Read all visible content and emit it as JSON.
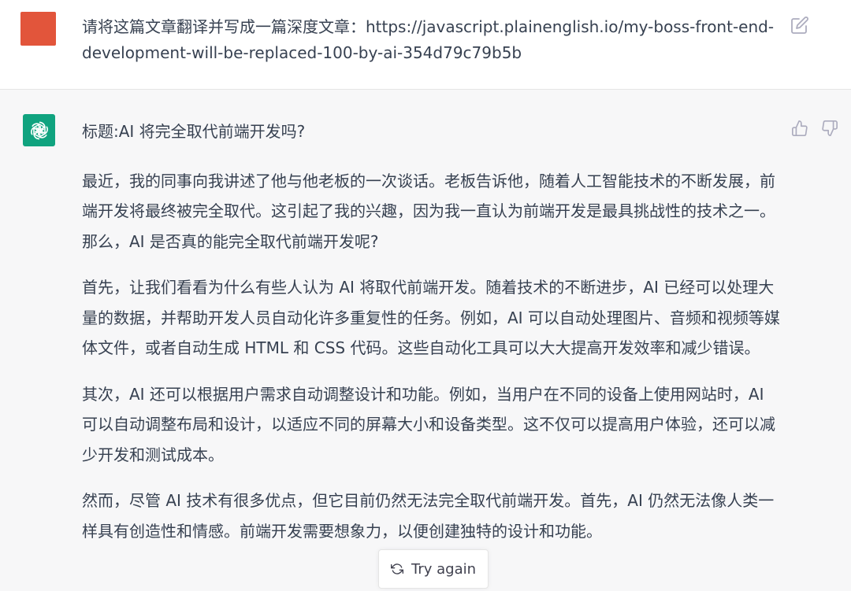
{
  "user_message": {
    "text": "请将这篇文章翻译并写成一篇深度文章：https://javascript.plainenglish.io/my-boss-front-end-development-will-be-replaced-100-by-ai-354d79c79b5b"
  },
  "assistant_message": {
    "title": "标题:AI 将完全取代前端开发吗?",
    "paragraphs": [
      "最近，我的同事向我讲述了他与他老板的一次谈话。老板告诉他，随着人工智能技术的不断发展，前端开发将最终被完全取代。这引起了我的兴趣，因为我一直认为前端开发是最具挑战性的技术之一。那么，AI 是否真的能完全取代前端开发呢?",
      "首先，让我们看看为什么有些人认为 AI 将取代前端开发。随着技术的不断进步，AI 已经可以处理大量的数据，并帮助开发人员自动化许多重复性的任务。例如，AI 可以自动处理图片、音频和视频等媒体文件，或者自动生成 HTML 和 CSS 代码。这些自动化工具可以大大提高开发效率和减少错误。",
      "其次，AI 还可以根据用户需求自动调整设计和功能。例如，当用户在不同的设备上使用网站时，AI 可以自动调整布局和设计，以适应不同的屏幕大小和设备类型。这不仅可以提高用户体验，还可以减少开发和测试成本。",
      "然而，尽管 AI 技术有很多优点，但它目前仍然无法完全取代前端开发。首先，AI 仍然无法像人类一样具有创造性和情感。前端开发需要想象力，以便创建独特的设计和功能。"
    ]
  },
  "controls": {
    "try_again_label": "Try again"
  },
  "icons": {
    "edit": "edit-icon",
    "thumb_up": "thumbs-up-icon",
    "thumb_down": "thumbs-down-icon",
    "regenerate": "refresh-icon",
    "assistant_logo": "openai-logo-icon"
  },
  "colors": {
    "user_avatar": "#e2553b",
    "assistant_avatar": "#10a37f",
    "assistant_bg": "#f7f7f8",
    "user_bg": "#ffffff"
  }
}
